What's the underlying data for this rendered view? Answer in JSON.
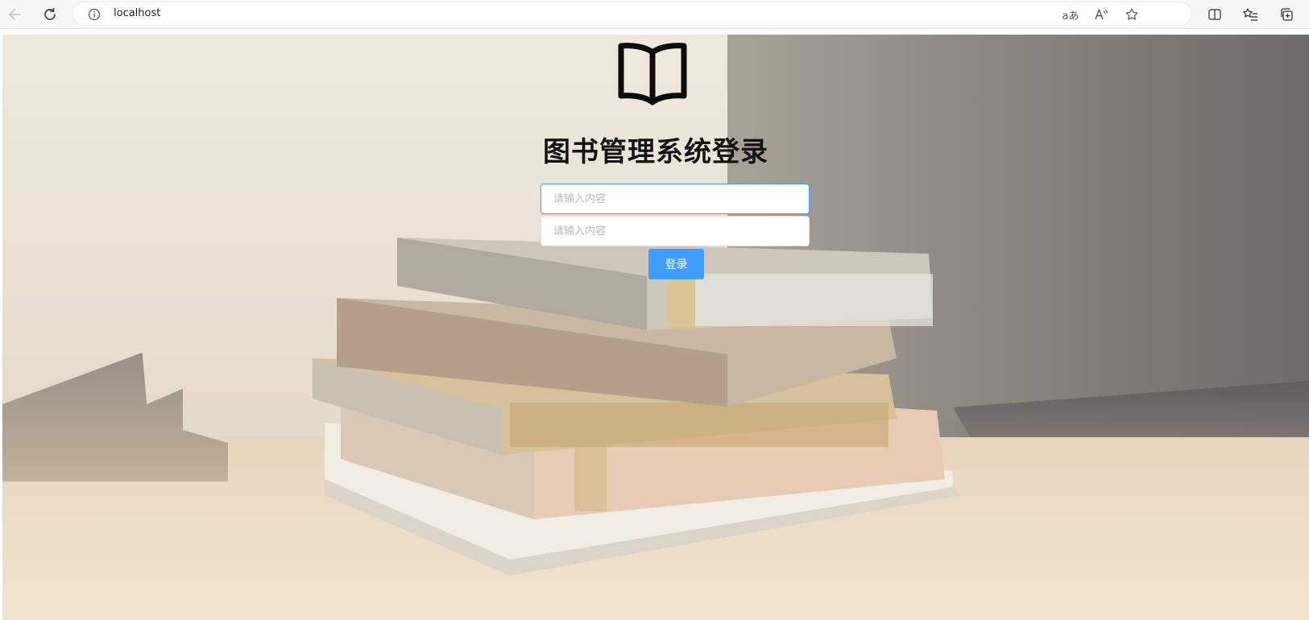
{
  "browser": {
    "url": "localhost",
    "back_icon": "arrow-left-icon",
    "reload_icon": "reload-icon",
    "info_icon": "info-icon",
    "read_aloud_label": "aあ",
    "reader_label": "A͓"
  },
  "login": {
    "logo_icon": "open-book-icon",
    "title": "图书管理系统登录",
    "username_placeholder": "请输入内容",
    "password_placeholder": "请输入内容",
    "submit_label": "登录"
  },
  "colors": {
    "accent": "#409eff",
    "input_focus_border": "#409eff",
    "input_border": "#dcdfe6"
  }
}
